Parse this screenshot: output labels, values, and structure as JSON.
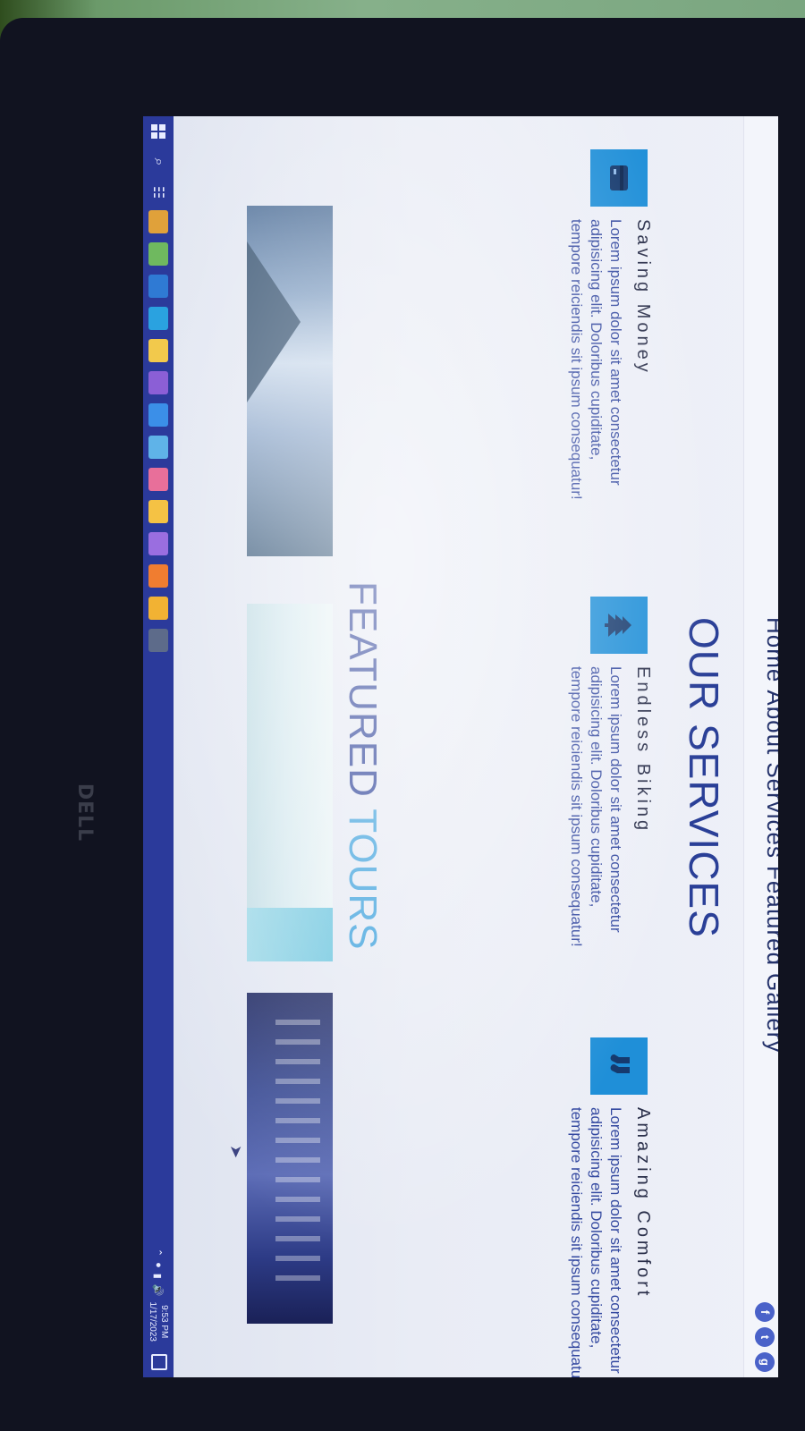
{
  "nav": {
    "links": [
      "Home",
      "About",
      "Services",
      "Featured",
      "Gallery"
    ],
    "social": [
      "f",
      "t",
      "g"
    ]
  },
  "services": {
    "heading": "OUR SERVICES",
    "items": [
      {
        "title": "Saving Money",
        "icon": "credit-card-icon",
        "text": "Lorem ipsum dolor sit amet consectetur adipisicing elit. Doloribus cupiditate, tempore reiciendis sit ipsum consequatur!"
      },
      {
        "title": "Endless Biking",
        "icon": "tree-icon",
        "text": "Lorem ipsum dolor sit amet consectetur adipisicing elit. Doloribus cupiditate, tempore reiciendis sit ipsum consequatur!"
      },
      {
        "title": "Amazing Comfort",
        "icon": "socks-icon",
        "text": "Lorem ipsum dolor sit amet consectetur adipisicing elit. Doloribus cupiditate, tempore reiciendis sit ipsum consequatur!"
      }
    ]
  },
  "featured": {
    "heading_part1": "FEATURED",
    "heading_part2": "TOURS",
    "tours": [
      "mountain-photo",
      "beach-palm-photo",
      "city-night-photo"
    ]
  },
  "taskbar": {
    "time": "9:53 PM",
    "date": "1/17/2023"
  },
  "device": {
    "brand": "DELL"
  },
  "colors": {
    "heading_blue": "#2a3f97",
    "accent_blue": "#3fa2dd",
    "icon_box": "#1f8fd8",
    "taskbar": "#2b3a9b"
  }
}
